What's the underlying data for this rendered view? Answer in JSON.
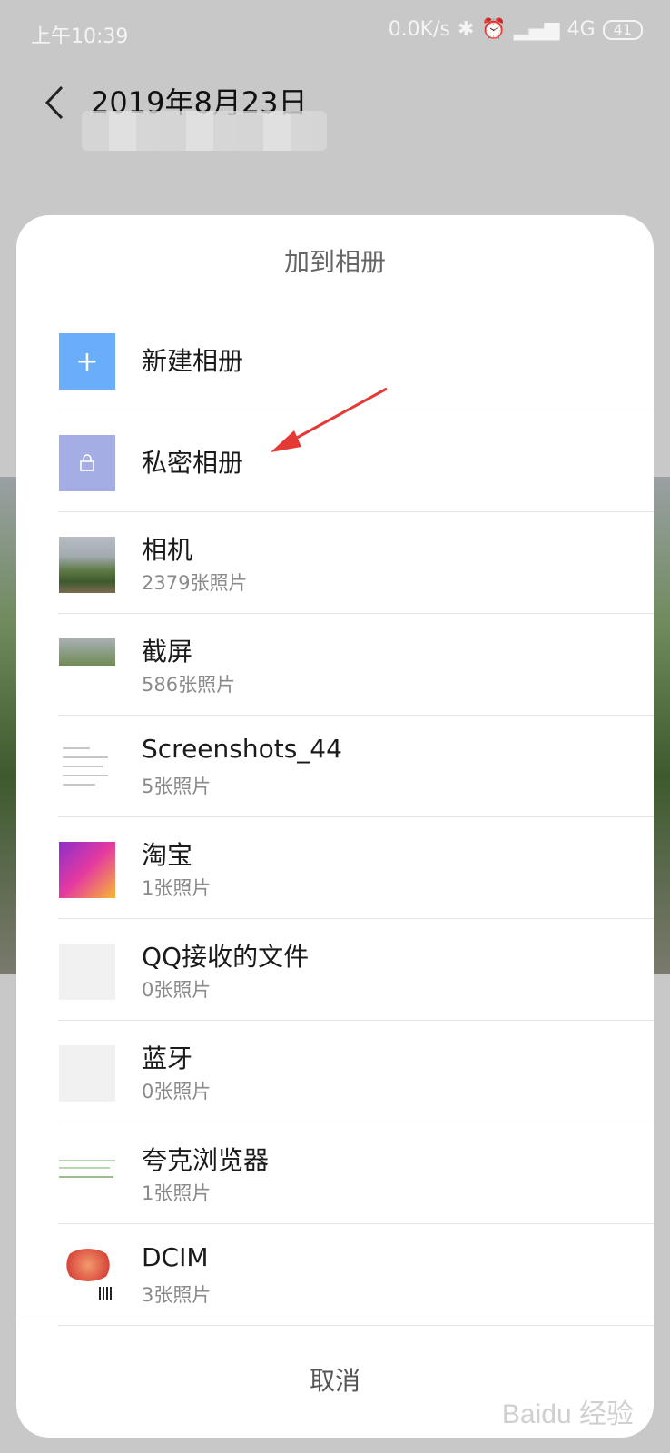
{
  "status_bar": {
    "time": "上午10:39",
    "net_speed": "0.0K/s",
    "network": "4G",
    "battery": "41"
  },
  "header": {
    "title": "2019年8月23日"
  },
  "sheet": {
    "title": "加到相册",
    "albums": [
      {
        "name": "新建相册",
        "thumb": "plus-icon"
      },
      {
        "name": "私密相册",
        "thumb": "lock-icon"
      },
      {
        "name": "相机",
        "count": "2379张照片"
      },
      {
        "name": "截屏",
        "count": "586张照片"
      },
      {
        "name": "Screenshots_44",
        "count": "5张照片"
      },
      {
        "name": "淘宝",
        "count": "1张照片"
      },
      {
        "name": "QQ接收的文件",
        "count": "0张照片"
      },
      {
        "name": "蓝牙",
        "count": "0张照片"
      },
      {
        "name": "夸克浏览器",
        "count": "1张照片"
      },
      {
        "name": "DCIM",
        "count": "3张照片"
      }
    ],
    "cancel_label": "取消"
  },
  "colors": {
    "new_album": "#6aaef9",
    "private_album": "#a5aee4",
    "arrow": "#e53935"
  }
}
